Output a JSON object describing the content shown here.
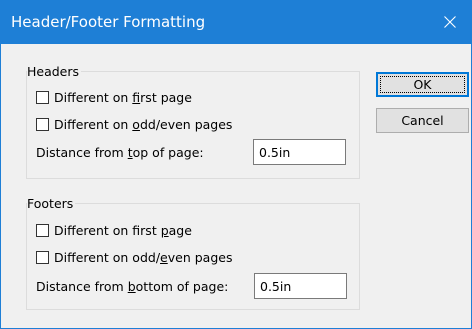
{
  "window": {
    "title": "Header/Footer Formatting",
    "close_icon": "close-icon"
  },
  "headers": {
    "legend": "Headers",
    "first_page": {
      "pre": "Different on ",
      "accel": "f",
      "post": "irst page",
      "checked": false
    },
    "odd_even": {
      "pre": "Different on ",
      "accel": "o",
      "post": "dd/even pages",
      "checked": false
    },
    "distance": {
      "pre": "Distance from ",
      "accel": "t",
      "post": "op of page:",
      "value": "0.5in"
    }
  },
  "footers": {
    "legend": "Footers",
    "first_page": {
      "pre": "Different on first ",
      "accel": "p",
      "post": "age",
      "checked": false
    },
    "odd_even": {
      "pre": "Different on odd/",
      "accel": "e",
      "post": "ven pages",
      "checked": false
    },
    "distance": {
      "pre": "Distance from ",
      "accel": "b",
      "post": "ottom of page:",
      "value": "0.5in"
    }
  },
  "buttons": {
    "ok": "OK",
    "cancel": "Cancel"
  }
}
